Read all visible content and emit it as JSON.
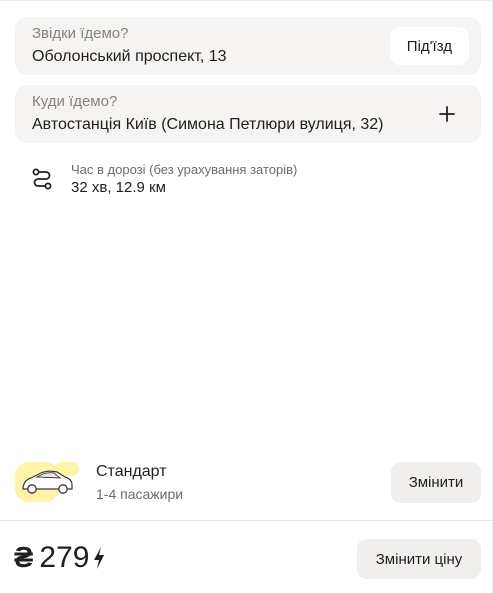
{
  "from": {
    "label": "Звідки їдемо?",
    "value": "Оболонський проспект, 13",
    "entrance_button": "Під'їзд"
  },
  "to": {
    "label": "Куди їдемо?",
    "value": "Автостанція Київ (Симона Петлюри вулиця, 32)",
    "add_icon": "plus-icon"
  },
  "route": {
    "label": "Час в дорозі (без урахування заторів)",
    "value": "32 хв, 12.9 км",
    "icon": "route-icon"
  },
  "tariff": {
    "name": "Стандарт",
    "seats": "1-4 пасажири",
    "change_button": "Змінити",
    "icon": "car-icon",
    "accent_color": "#fce000"
  },
  "price": {
    "currency": "₴",
    "amount": "279",
    "icon": "lightning-icon",
    "change_button": "Змінити ціну"
  }
}
